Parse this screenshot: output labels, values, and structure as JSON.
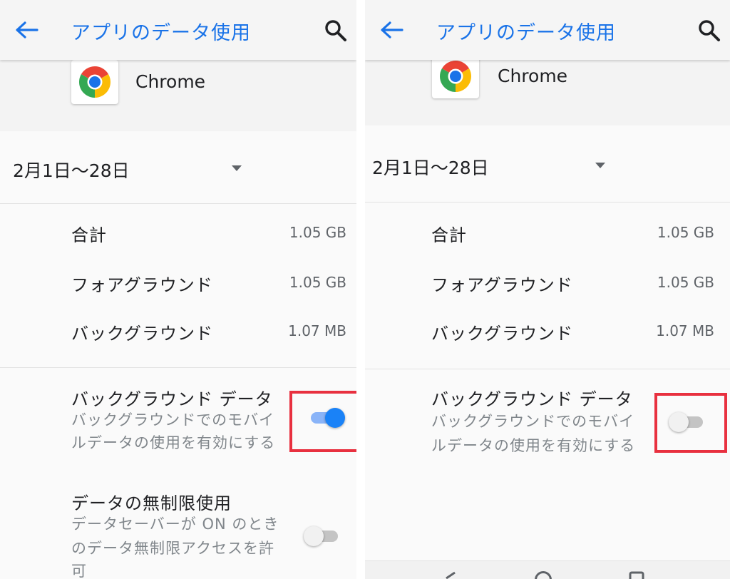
{
  "screens": [
    {
      "appbar": {
        "title": "アプリのデータ使用"
      },
      "app": {
        "name": "Chrome"
      },
      "period": {
        "label": "2月1日〜28日"
      },
      "usage": [
        {
          "label": "合計",
          "value": "1.05 GB"
        },
        {
          "label": "フォアグラウンド",
          "value": "1.05 GB"
        },
        {
          "label": "バックグラウンド",
          "value": "1.07 MB"
        }
      ],
      "background_data": {
        "title": "バックグラウンド データ",
        "desc_line1": "バックグラウンドでのモバイ",
        "desc_line2": "ルデータの使用を有効にする",
        "enabled": true
      },
      "unrestricted_data": {
        "title": "データの無制限使用",
        "desc_line1": "データセーバーが ON のとき",
        "desc_line2": "のデータ無制限アクセスを許",
        "desc_line3": "可",
        "enabled": false
      }
    },
    {
      "appbar": {
        "title": "アプリのデータ使用"
      },
      "app": {
        "name": "Chrome"
      },
      "period": {
        "label": "2月1日〜28日"
      },
      "usage": [
        {
          "label": "合計",
          "value": "1.05 GB"
        },
        {
          "label": "フォアグラウンド",
          "value": "1.05 GB"
        },
        {
          "label": "バックグラウンド",
          "value": "1.07 MB"
        }
      ],
      "background_data": {
        "title": "バックグラウンド データ",
        "desc_line1": "バックグラウンドでのモバイ",
        "desc_line2": "ルデータの使用を有効にする",
        "enabled": false
      }
    }
  ],
  "icons": {
    "back": "arrow-left-icon",
    "search": "magnifier-icon",
    "app": "chrome-logo-icon",
    "dropdown": "triangle-down-icon"
  },
  "colors": {
    "accent": "#1a73e8",
    "toggle_on": "#1a82f7",
    "highlight": "#e8303f"
  }
}
